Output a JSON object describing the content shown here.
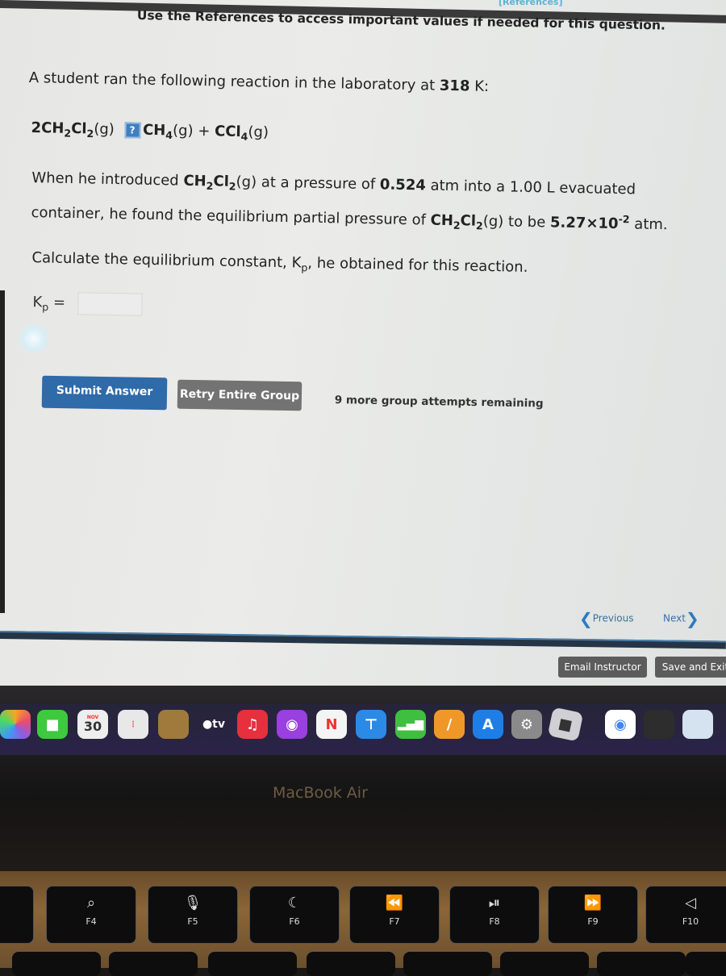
{
  "header": {
    "references_link": "[References]",
    "reference_note": "Use the References to access important values if needed for this question."
  },
  "question": {
    "intro_prefix": "A student ran the following reaction in the laboratory at ",
    "temperature": "318",
    "temperature_unit": " K:",
    "equation": {
      "coef": "2",
      "reactant": "CH",
      "r_sub1": "2",
      "r_mid": "Cl",
      "r_sub2": "2",
      "r_phase": "(g)",
      "arrow_icon": "?",
      "product1": "CH",
      "p1_sub": "4",
      "p1_phase": "(g)",
      "plus": " + ",
      "product2": "CCl",
      "p2_sub": "4",
      "p2_phase": "(g)"
    },
    "p1_a": "When he introduced ",
    "p1_species": "CH",
    "p1_species_sub1": "2",
    "p1_species_mid": "Cl",
    "p1_species_sub2": "2",
    "p1_phase": "(g)",
    "p1_b": " at a pressure of ",
    "initial_pressure": "0.524",
    "p1_c": " atm into a 1.00 L evacuated",
    "p2_a": "container, he found the equilibrium partial pressure of ",
    "p2_phase": "(g) to be ",
    "eq_pressure_mantissa": "5.27×10",
    "eq_pressure_exp": "-2",
    "p2_unit": " atm.",
    "p3_a": "Calculate the equilibrium constant, K",
    "p3_sub": "p",
    "p3_b": ", he obtained for this reaction."
  },
  "answer": {
    "label": "K",
    "label_sub": "p",
    "equals": " = ",
    "value": ""
  },
  "buttons": {
    "submit": "Submit Answer",
    "retry": "Retry Entire Group",
    "attempts_remaining": "9 more group attempts remaining",
    "previous": "Previous",
    "next": "Next",
    "email_instructor": "Email Instructor",
    "save_exit": "Save and Exit"
  },
  "dock": {
    "calendar_month": "NOV",
    "calendar_day": "30",
    "tv_label": "●tv",
    "apps": [
      "photos",
      "facetime",
      "calendar",
      "reminders",
      "contacts",
      "apple-tv",
      "music",
      "podcasts",
      "news",
      "keynote",
      "numbers",
      "pages",
      "app-store",
      "system-settings",
      "roblox",
      "chrome",
      "terminal",
      "preview"
    ]
  },
  "bezel_label": "MacBook Air",
  "keys": [
    {
      "glyph": "⌕",
      "label": "F4"
    },
    {
      "glyph": "🎙",
      "label": "F5"
    },
    {
      "glyph": "☾",
      "label": "F6"
    },
    {
      "glyph": "⏪",
      "label": "F7"
    },
    {
      "glyph": "⏯",
      "label": "F8"
    },
    {
      "glyph": "⏩",
      "label": "F9"
    },
    {
      "glyph": "◁",
      "label": "F10"
    }
  ]
}
